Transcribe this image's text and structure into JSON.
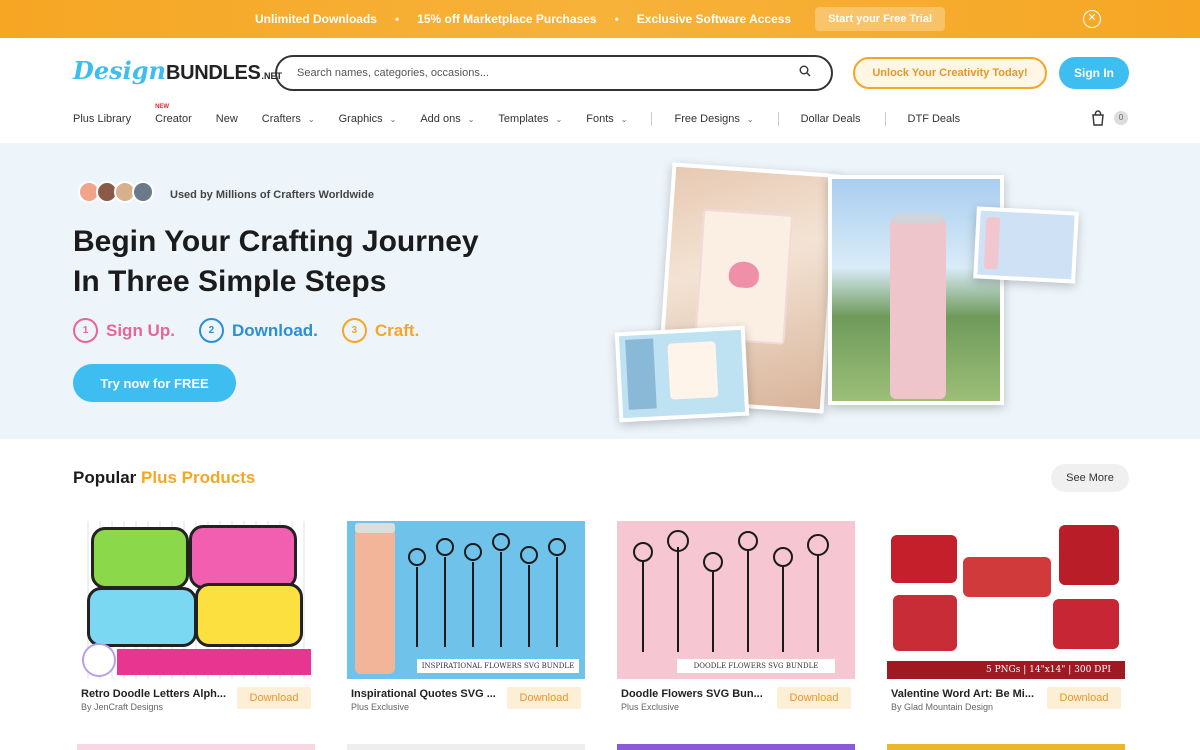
{
  "promo": {
    "items": [
      "Unlimited Downloads",
      "15% off Marketplace Purchases",
      "Exclusive Software Access"
    ],
    "cta": "Start your Free Trial",
    "close_icon": "close-circle-icon"
  },
  "header": {
    "logo_script": "Design",
    "logo_bold": "BUNDLES",
    "logo_net": ".NET",
    "search_placeholder": "Search names, categories, occasions...",
    "search_icon": "search-icon",
    "unlock_label": "Unlock Your Creativity Today!",
    "signin_label": "Sign In"
  },
  "nav": {
    "items": [
      {
        "label": "Plus Library",
        "dropdown": false
      },
      {
        "label": "Creator",
        "dropdown": false,
        "badge": "NEW"
      },
      {
        "label": "New",
        "dropdown": false
      },
      {
        "label": "Crafters",
        "dropdown": true
      },
      {
        "label": "Graphics",
        "dropdown": true
      },
      {
        "label": "Add ons",
        "dropdown": true
      },
      {
        "label": "Templates",
        "dropdown": true
      },
      {
        "label": "Fonts",
        "dropdown": true
      },
      {
        "label": "Free Designs",
        "dropdown": true
      },
      {
        "label": "Dollar Deals",
        "dropdown": false
      },
      {
        "label": "DTF Deals",
        "dropdown": false
      }
    ],
    "cart_icon": "shopping-bag-icon",
    "cart_count": "0"
  },
  "hero": {
    "used_by": "Used by Millions of Crafters Worldwide",
    "headline_line1": "Begin Your Crafting Journey",
    "headline_line2": "In Three Simple Steps",
    "steps": [
      {
        "num": "1",
        "label": "Sign Up.",
        "color": "#e8649a"
      },
      {
        "num": "2",
        "label": "Download.",
        "color": "#2b8fd6"
      },
      {
        "num": "3",
        "label": "Craft.",
        "color": "#f5a623"
      }
    ],
    "cta": "Try now for FREE"
  },
  "popular": {
    "title_start": "Popular",
    "title_accent": "Plus Products",
    "see_more": "See More",
    "products": [
      {
        "name": "Retro Doodle Letters Alph...",
        "by": "By JenCraft Designs",
        "download": "Download",
        "band": ""
      },
      {
        "name": "Inspirational Quotes SVG ...",
        "by": "Plus Exclusive",
        "download": "Download",
        "band": "INSPIRATIONAL FLOWERS SVG BUNDLE"
      },
      {
        "name": "Doodle Flowers SVG Bun...",
        "by": "Plus Exclusive",
        "download": "Download",
        "band": "DOODLE FLOWERS SVG BUNDLE"
      },
      {
        "name": "Valentine Word Art: Be Mi...",
        "by": "By Glad Mountain Design",
        "download": "Download",
        "band": "5 PNGs | 14\"x14\" | 300 DPI"
      }
    ]
  },
  "colors": {
    "accent_blue": "#3dbdf0",
    "accent_orange": "#f5a623",
    "hero_bg": "#edf5fb"
  }
}
